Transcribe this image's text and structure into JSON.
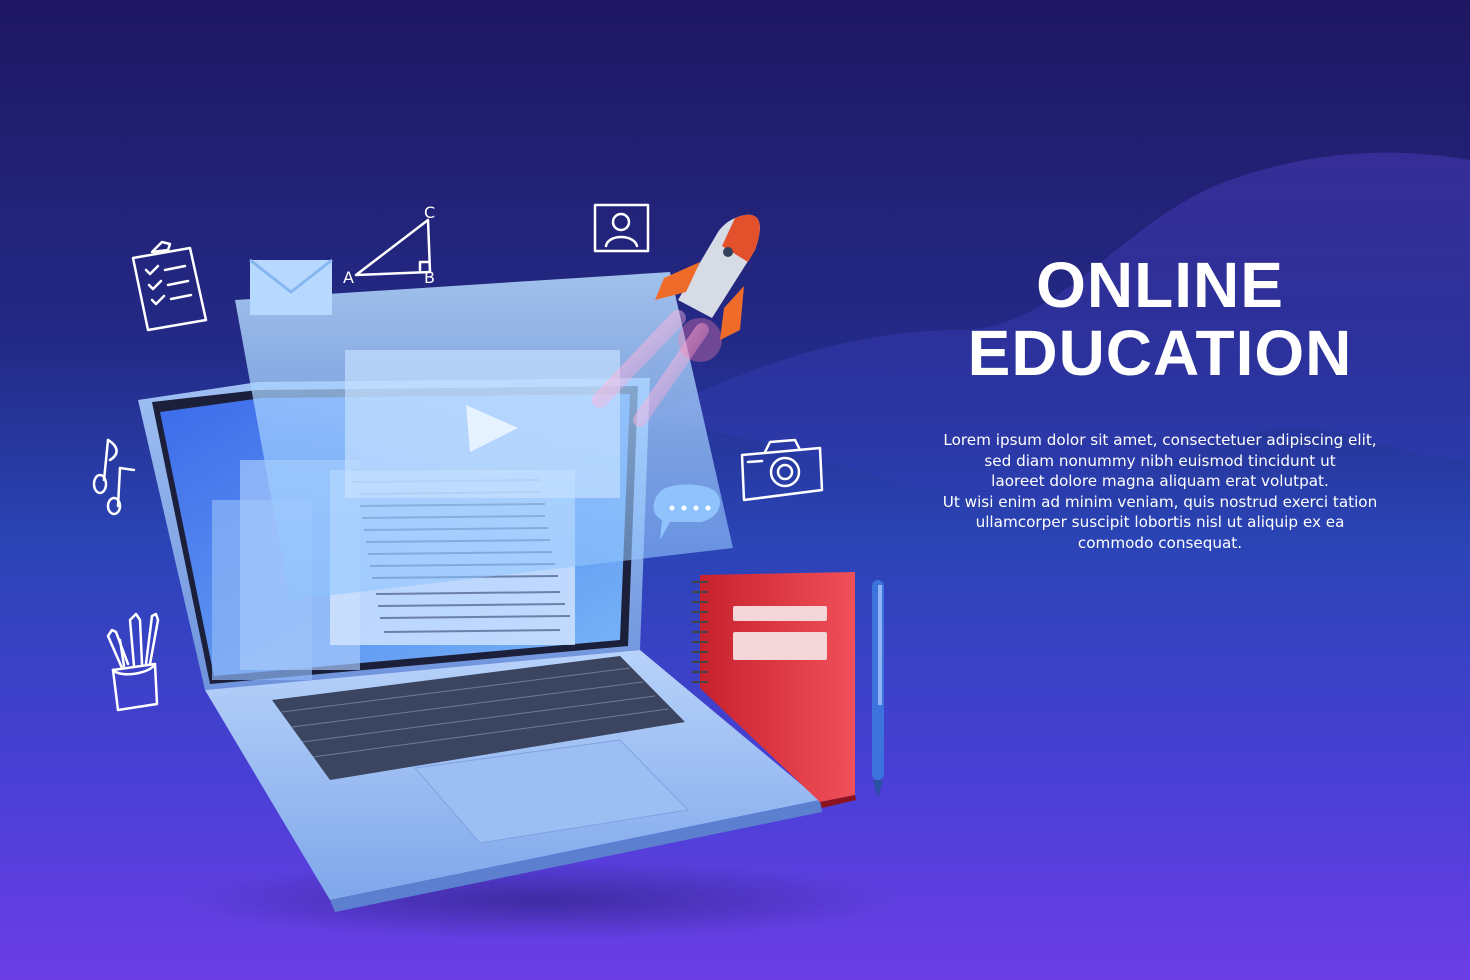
{
  "heading": {
    "line1": "ONLINE",
    "line2": "EDUCATION"
  },
  "description": {
    "lines": [
      "Lorem ipsum dolor sit amet, consectetuer adipiscing elit,",
      "sed diam nonummy  nibh euismod tincidunt ut",
      "laoreet dolore magna aliquam erat volutpat.",
      "Ut wisi enim ad minim veniam, quis nostrud exerci tation",
      "ullamcorper suscipit lobortis nisl ut aliquip ex ea",
      "commodo consequat."
    ]
  },
  "diagram_labels": {
    "a": "A",
    "b": "B",
    "c": "C"
  },
  "colors": {
    "background_top": "#1f1763",
    "background_bottom": "#6c3ee6",
    "wave": "#3b3fb8",
    "notebook": "#e2383f",
    "laptop_body": "#8fb8f2",
    "screen_glow": "#6fa4f5",
    "pen": "#3b6fd8"
  },
  "icons": [
    "clipboard-checklist-icon",
    "triangle-geometry-icon",
    "profile-card-icon",
    "rocket-icon",
    "music-note-icon",
    "camera-icon",
    "pencil-cup-icon",
    "mail-envelope-icon",
    "play-icon",
    "chat-bubble-icon"
  ]
}
